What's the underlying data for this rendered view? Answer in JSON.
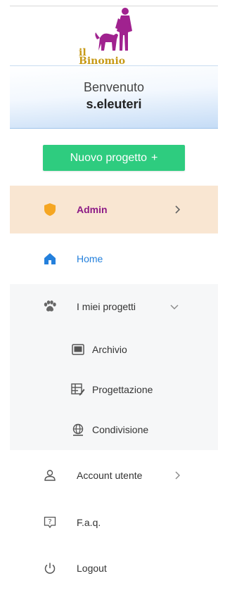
{
  "logo": {
    "line1": "il",
    "line2": "Binomio"
  },
  "welcome": {
    "greeting": "Benvenuto",
    "username": "s.eleuteri"
  },
  "new_project": {
    "label": "Nuovo progetto",
    "plus": "+"
  },
  "menu": {
    "admin": {
      "label": "Admin",
      "icon": "shield-icon"
    },
    "home": {
      "label": "Home",
      "icon": "home-icon"
    },
    "projects": {
      "label": "I miei progetti",
      "icon": "paw-icon",
      "expanded": true,
      "children": [
        {
          "label": "Archivio",
          "icon": "archive-icon"
        },
        {
          "label": "Progettazione",
          "icon": "design-icon"
        },
        {
          "label": "Condivisione",
          "icon": "globe-share-icon"
        }
      ]
    },
    "account": {
      "label": "Account utente",
      "icon": "user-icon"
    },
    "faq": {
      "label": "F.a.q.",
      "icon": "help-icon"
    },
    "logout": {
      "label": "Logout",
      "icon": "power-icon"
    }
  },
  "colors": {
    "accent_green": "#2ecc7f",
    "admin_bg": "#f9e6d2",
    "admin_text": "#8c1a86",
    "shield": "#f5a623",
    "home_blue": "#2480dc",
    "logo_gold": "#c79a17",
    "logo_figure": "#a0228f"
  }
}
